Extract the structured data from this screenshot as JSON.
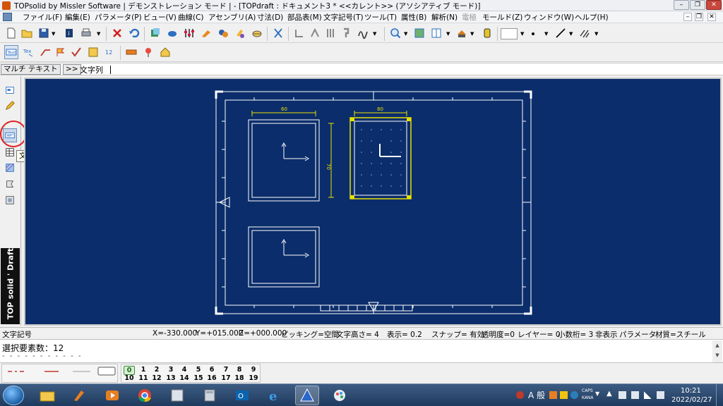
{
  "titlebar": {
    "title": "TOPsolid by Missler Software | デモンストレーション モード | - [TOPdraft : ドキュメント3 *   <<カレント>> (アソシアティブ モード)]"
  },
  "menubar": {
    "items": [
      {
        "label": "ファイル(F)"
      },
      {
        "label": "編集(E)"
      },
      {
        "label": "パラメータ(P)"
      },
      {
        "label": "ビュー(V)"
      },
      {
        "label": "曲線(C)"
      },
      {
        "label": "アセンブリ(A)"
      },
      {
        "label": "寸法(D)"
      },
      {
        "label": "部品表(M)"
      },
      {
        "label": "文字記号(T)"
      },
      {
        "label": "ツール(T)"
      },
      {
        "label": "属性(B)"
      },
      {
        "label": "解析(N)"
      },
      {
        "label": "電極"
      },
      {
        "label": "モールド(Z)"
      },
      {
        "label": "ウィンドウ(W)"
      },
      {
        "label": "ヘルプ(H)"
      }
    ]
  },
  "commandline": {
    "mode_button": "マルチ テキスト",
    "more_button": ">>",
    "prompt": "文字列"
  },
  "sidebar": {
    "tooltip": "文字記号",
    "brand": "TOP solid ' Draft"
  },
  "drawing": {
    "dim_top_left": "60",
    "dim_top_right": "80",
    "dim_side": "70"
  },
  "statusbar": {
    "mode": "文字記号",
    "x": "X=-330.000",
    "y": "Y=+015.000",
    "z": "Z=+000.000",
    "picking": "ピッキング=空間",
    "text_height": "文字高さ=  4",
    "display": "表示=   0.2",
    "snap": "スナップ= 有効",
    "transparency": "透明度=0",
    "layer": "レイヤー=  0",
    "decimals": "小数桁= 3",
    "hidden": "非表示",
    "parameter": "パラメータ",
    "material": "材質=スチール"
  },
  "message": {
    "selected_count": "選択要素数：12",
    "dashes": "- - - - - - - - - - -"
  },
  "layers": {
    "row1": [
      "0",
      "1",
      "2",
      "3",
      "4",
      "5",
      "6",
      "7",
      "8",
      "9"
    ],
    "row2": [
      "10",
      "11",
      "12",
      "13",
      "14",
      "15",
      "16",
      "17",
      "18",
      "19"
    ],
    "active": "0"
  },
  "taskbar": {
    "ime": "A 般",
    "caps": "CAPS",
    "kana": "KANA",
    "time": "10:21",
    "date": "2022/02/27"
  },
  "colors": {
    "canvas_bg": "#0b2d6b",
    "drawing_line": "#ffffff",
    "dimension_line": "#e8e000",
    "selection": "#ffff00",
    "highlight_circle": "#e02020"
  }
}
